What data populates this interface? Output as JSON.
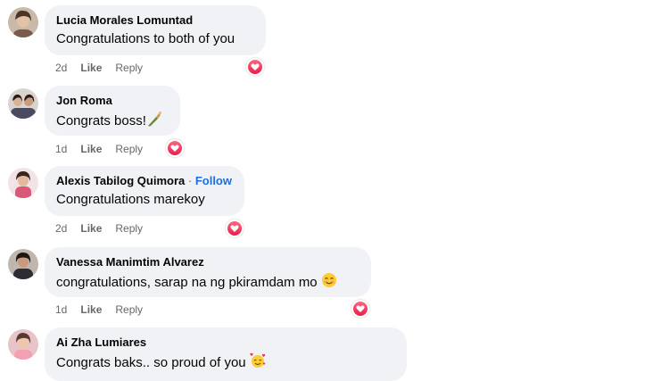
{
  "comments": [
    {
      "name": "Lucia Morales Lomuntad",
      "text": "Congratulations to both of you",
      "time": "2d",
      "like": "Like",
      "reply": "Reply",
      "reaction": "heart-icon"
    },
    {
      "name": "Jon Roma",
      "text": "Congrats boss!",
      "time": "1d",
      "like": "Like",
      "reply": "Reply",
      "reaction": "heart-icon",
      "emoji": "champagne-bottle-emoji"
    },
    {
      "name": "Alexis Tabilog Quimora",
      "follow_separator": "·",
      "follow": "Follow",
      "text": "Congratulations marekoy",
      "time": "2d",
      "like": "Like",
      "reply": "Reply",
      "reaction": "heart-icon"
    },
    {
      "name": "Vanessa Manimtim Alvarez",
      "text": "congratulations, sarap na ng pkiramdam mo",
      "time": "1d",
      "like": "Like",
      "reply": "Reply",
      "reaction": "heart-icon",
      "emoji": "smiling-face-emoji"
    },
    {
      "name": "Ai Zha Lumiares",
      "text": "Congrats baks.. so proud of you",
      "emoji": "smiling-face-with-hearts-emoji"
    }
  ],
  "colors": {
    "bubble": "#f0f2f5",
    "follow_link": "#216fdb",
    "meta_text": "#65676b",
    "heart": "#e61e4d"
  }
}
